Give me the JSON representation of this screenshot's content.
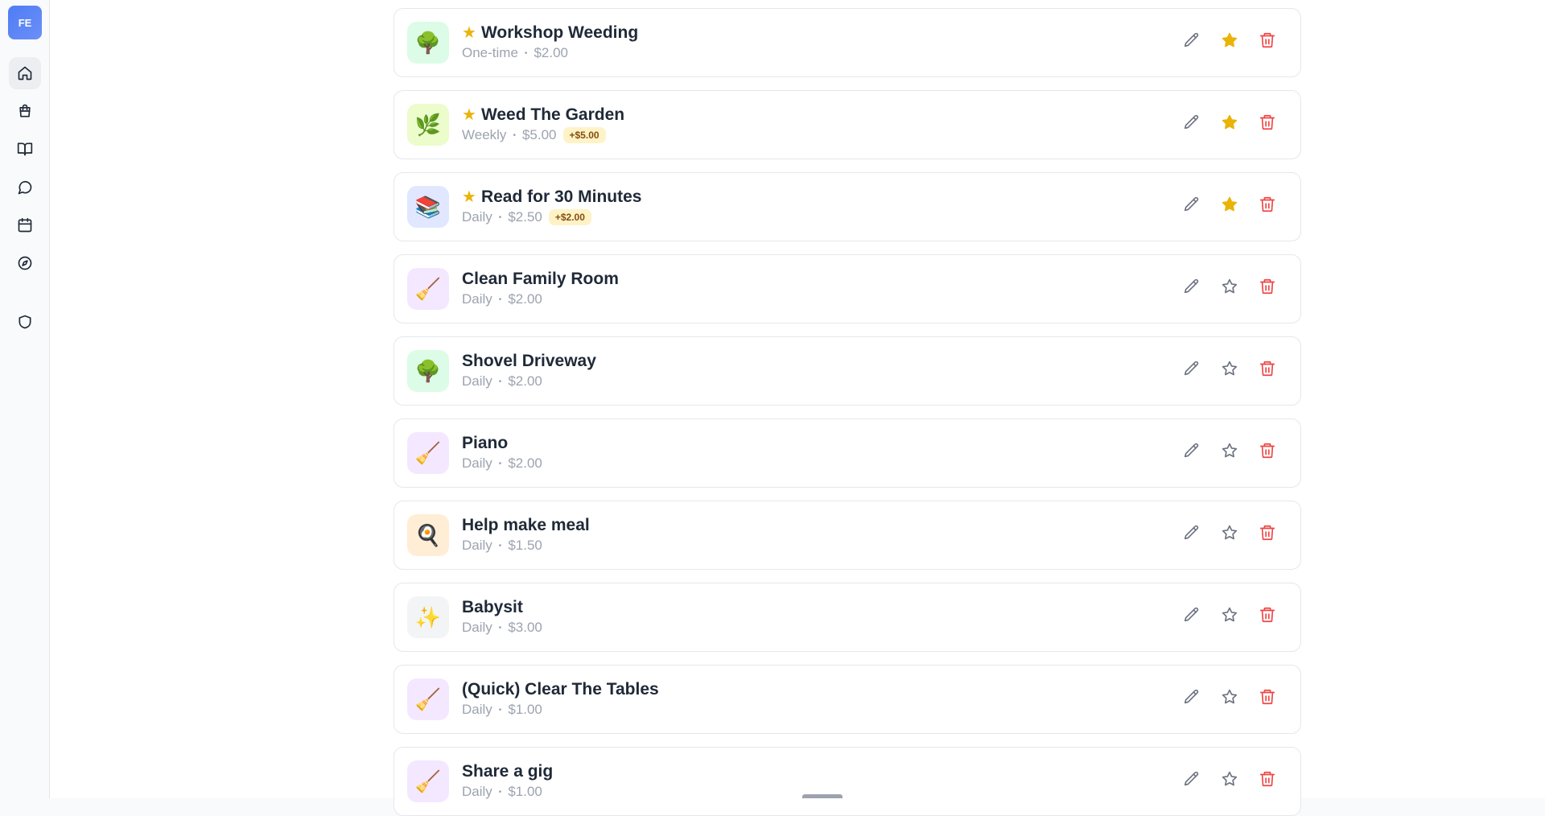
{
  "sidebar": {
    "avatar_initials": "FE",
    "nav": [
      {
        "name": "home-icon",
        "active": true
      },
      {
        "name": "shopping-bag-icon",
        "active": false
      },
      {
        "name": "book-icon",
        "active": false
      },
      {
        "name": "chat-icon",
        "active": false
      },
      {
        "name": "calendar-icon",
        "active": false
      },
      {
        "name": "compass-icon",
        "active": false
      },
      {
        "name": "shield-icon",
        "active": false
      }
    ]
  },
  "colors": {
    "star_active": "#eab308",
    "delete": "#ef4444",
    "icon_muted": "#6b7280",
    "badge_bg": "#fef3c7"
  },
  "chores": [
    {
      "title": "Workshop Weeding",
      "frequency": "One-time",
      "amount": "$2.00",
      "bonus": "",
      "favorite": true,
      "icon": "tree-icon",
      "glyph": "🌳",
      "icon_bg": "#dcfce7"
    },
    {
      "title": "Weed The Garden",
      "frequency": "Weekly",
      "amount": "$5.00",
      "bonus": "+$5.00",
      "favorite": true,
      "icon": "herb-icon",
      "glyph": "🌿",
      "icon_bg": "#ecfccb"
    },
    {
      "title": "Read for 30 Minutes",
      "frequency": "Daily",
      "amount": "$2.50",
      "bonus": "+$2.00",
      "favorite": true,
      "icon": "books-icon",
      "glyph": "📚",
      "icon_bg": "#e0e7ff"
    },
    {
      "title": "Clean Family Room",
      "frequency": "Daily",
      "amount": "$2.00",
      "bonus": "",
      "favorite": false,
      "icon": "broom-icon",
      "glyph": "🧹",
      "icon_bg": "#f3e8ff"
    },
    {
      "title": "Shovel Driveway",
      "frequency": "Daily",
      "amount": "$2.00",
      "bonus": "",
      "favorite": false,
      "icon": "tree-icon",
      "glyph": "🌳",
      "icon_bg": "#dcfce7"
    },
    {
      "title": "Piano",
      "frequency": "Daily",
      "amount": "$2.00",
      "bonus": "",
      "favorite": false,
      "icon": "broom-icon",
      "glyph": "🧹",
      "icon_bg": "#f3e8ff"
    },
    {
      "title": "Help make meal",
      "frequency": "Daily",
      "amount": "$1.50",
      "bonus": "",
      "favorite": false,
      "icon": "frying-pan-icon",
      "glyph": "🍳",
      "icon_bg": "#ffedd5"
    },
    {
      "title": "Babysit",
      "frequency": "Daily",
      "amount": "$3.00",
      "bonus": "",
      "favorite": false,
      "icon": "sparkles-icon",
      "glyph": "✨",
      "icon_bg": "#f3f4f6"
    },
    {
      "title": "(Quick) Clear The Tables",
      "frequency": "Daily",
      "amount": "$1.00",
      "bonus": "",
      "favorite": false,
      "icon": "broom-icon",
      "glyph": "🧹",
      "icon_bg": "#f3e8ff"
    },
    {
      "title": "Share a gig",
      "frequency": "Daily",
      "amount": "$1.00",
      "bonus": "",
      "favorite": false,
      "icon": "broom-icon",
      "glyph": "🧹",
      "icon_bg": "#f3e8ff"
    }
  ]
}
